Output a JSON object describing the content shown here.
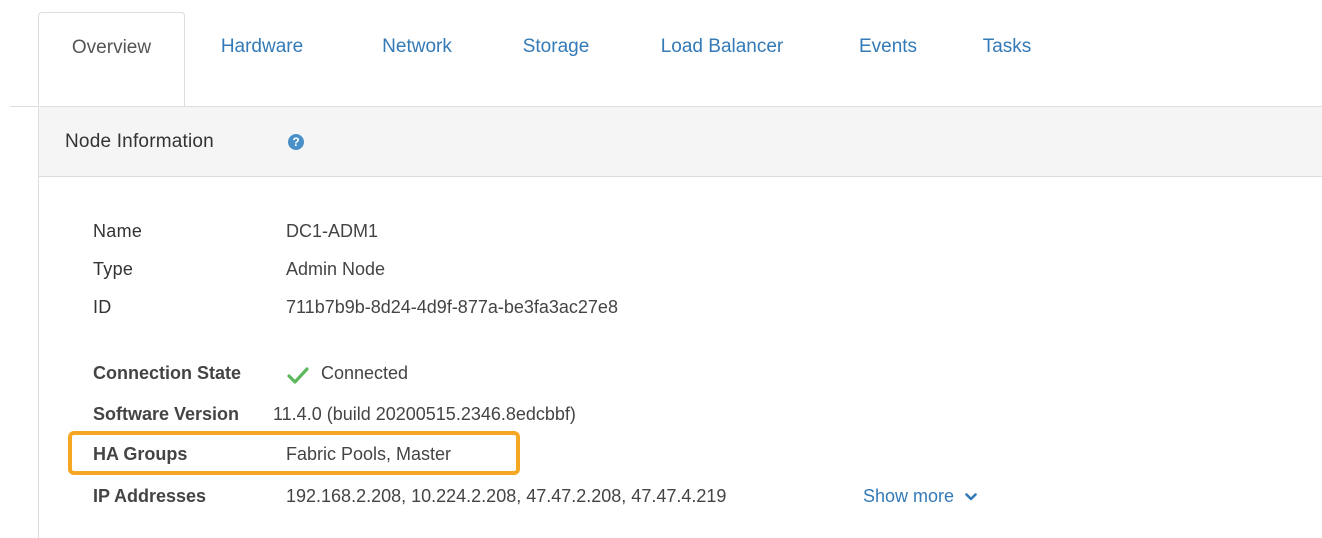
{
  "tabs": [
    {
      "label": "Overview",
      "active": true
    },
    {
      "label": "Hardware",
      "active": false
    },
    {
      "label": "Network",
      "active": false
    },
    {
      "label": "Storage",
      "active": false
    },
    {
      "label": "Load Balancer",
      "active": false
    },
    {
      "label": "Events",
      "active": false
    },
    {
      "label": "Tasks",
      "active": false
    }
  ],
  "panel": {
    "title": "Node Information",
    "help_icon": "question-circle-icon",
    "help_glyph": "?"
  },
  "info": {
    "name": {
      "label": "Name",
      "value": "DC1-ADM1"
    },
    "type": {
      "label": "Type",
      "value": "Admin Node"
    },
    "id": {
      "label": "ID",
      "value": "711b7b9b-8d24-4d9f-877a-be3fa3ac27e8"
    },
    "connection_state": {
      "label": "Connection State",
      "value": "Connected",
      "icon": "check-icon"
    },
    "software_version": {
      "label": "Software Version",
      "value": "11.4.0 (build 20200515.2346.8edcbbf)"
    },
    "ha_groups": {
      "label": "HA Groups",
      "value": "Fabric Pools, Master"
    },
    "ip_addresses": {
      "label": "IP Addresses",
      "value": "192.168.2.208, 10.224.2.208, 47.47.2.208, 47.47.4.219",
      "show_more": "Show more"
    }
  },
  "colors": {
    "link": "#337ab7",
    "highlight": "#f5a623",
    "check": "#5cb85c",
    "help": "#4a90c8"
  }
}
